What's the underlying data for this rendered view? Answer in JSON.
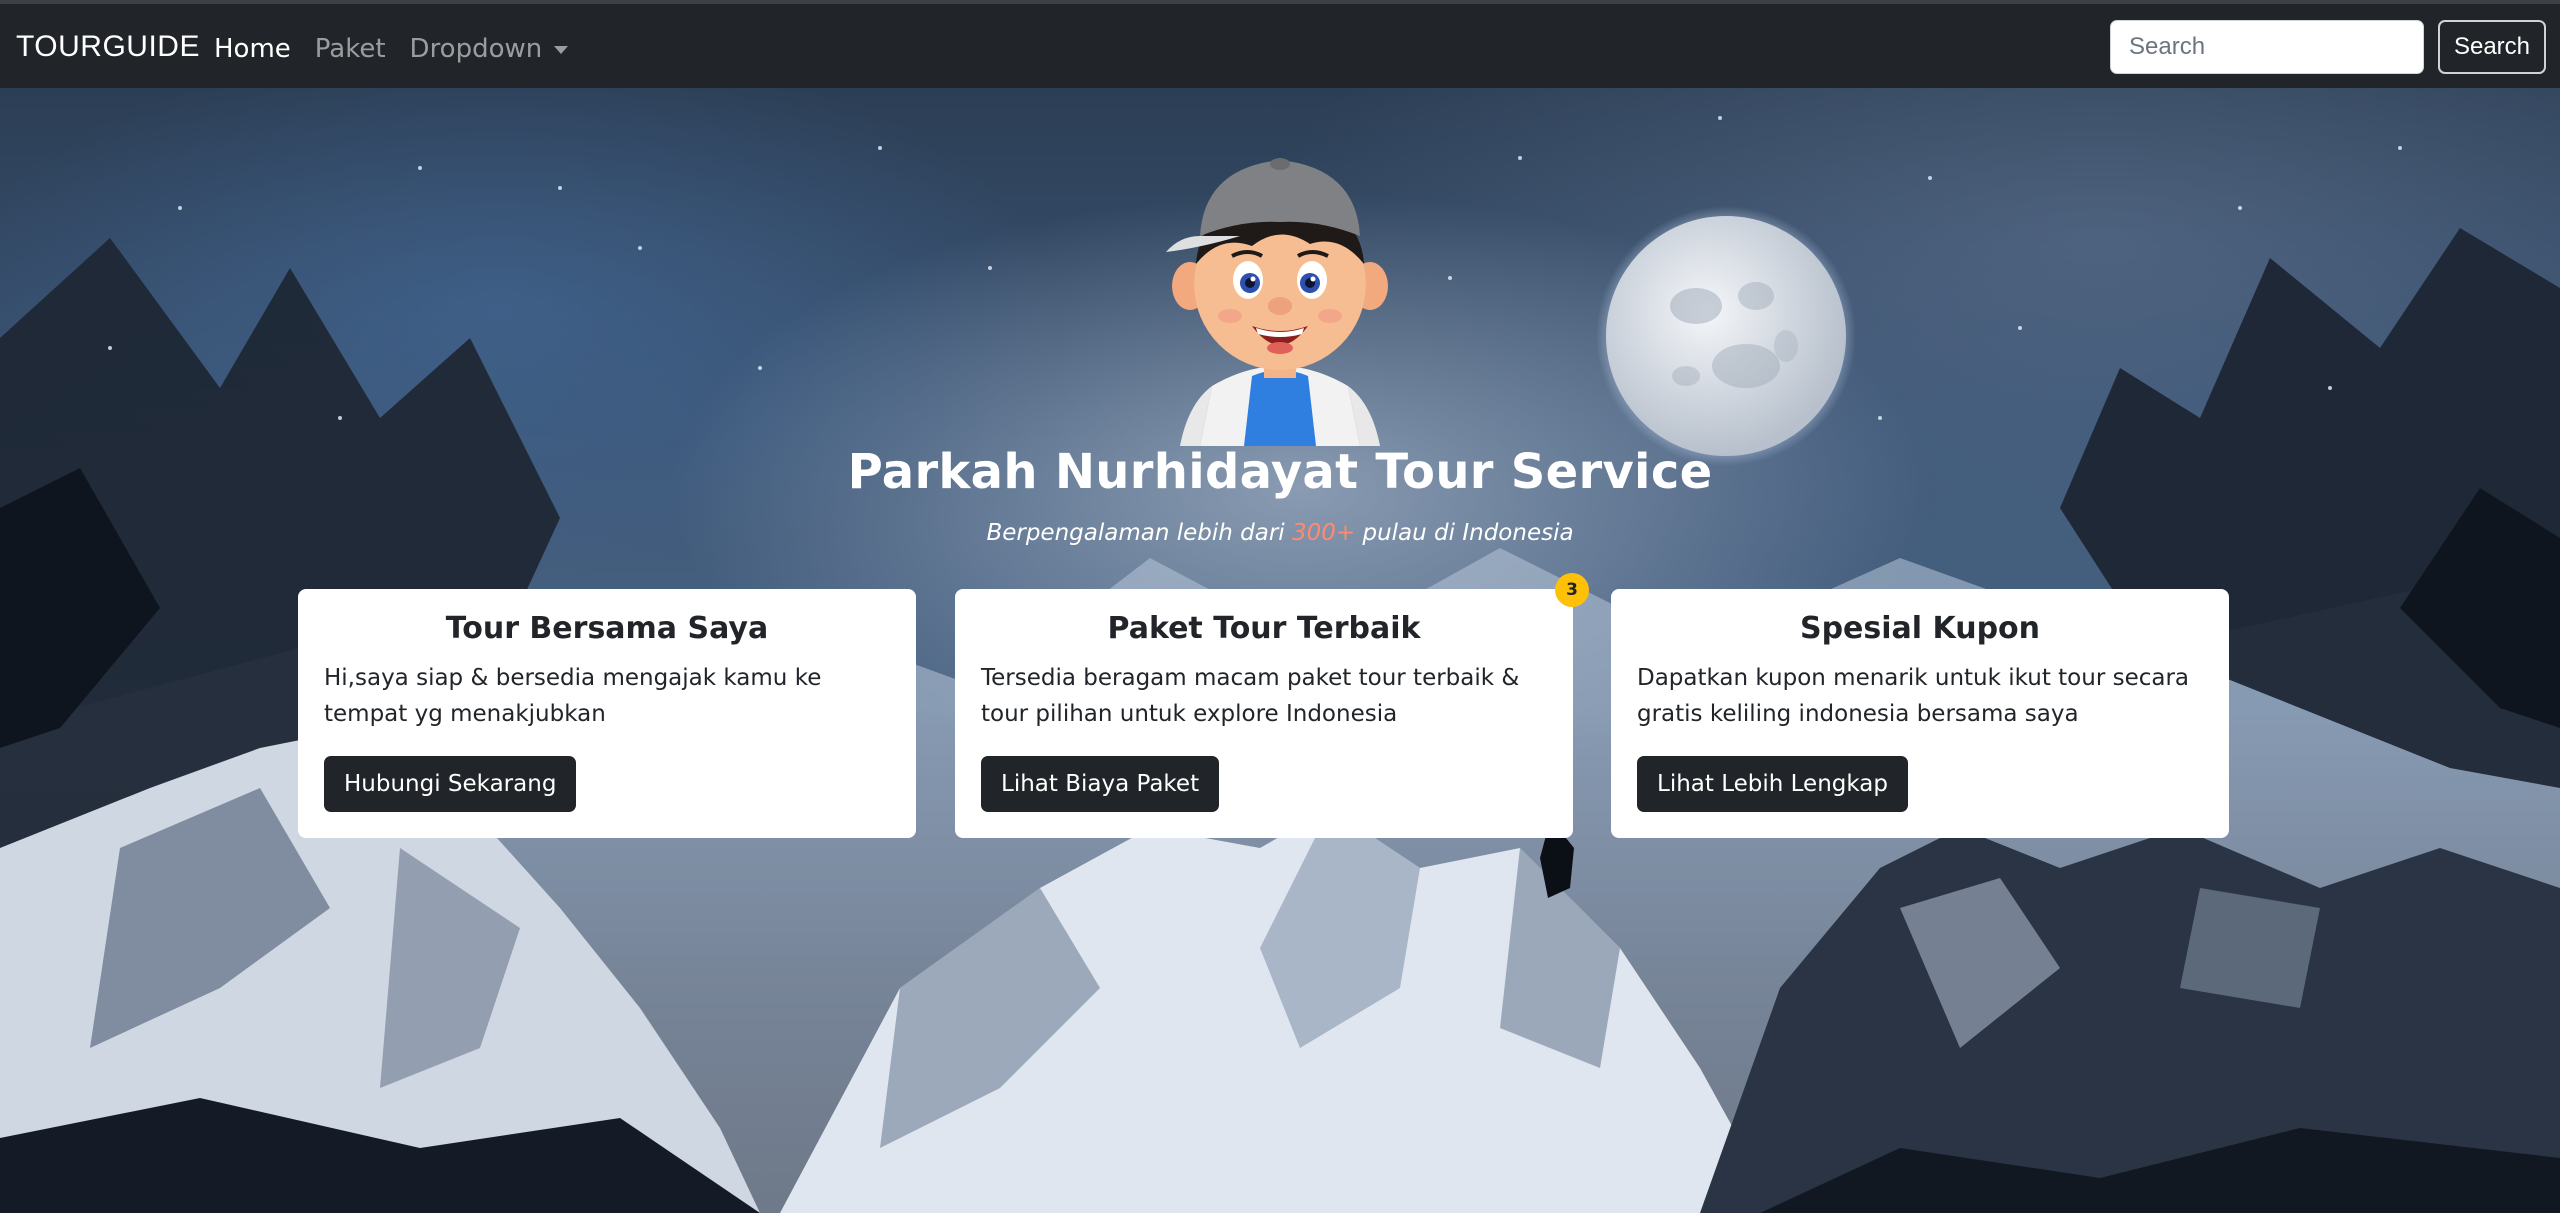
{
  "navbar": {
    "brand": "TOURGUIDE",
    "links": [
      {
        "label": "Home",
        "active": true
      },
      {
        "label": "Paket",
        "active": false
      },
      {
        "label": "Dropdown",
        "active": false
      }
    ],
    "search_placeholder": "Search",
    "search_button": "Search"
  },
  "hero": {
    "title": "Parkah Nurhidayat Tour Service",
    "subtitle_before": "Berpengalaman lebih dari ",
    "subtitle_highlight": "300+",
    "subtitle_after": " pulau di Indonesia"
  },
  "cards": [
    {
      "title": "Tour Bersama Saya",
      "text": "Hi,saya siap & bersedia mengajak kamu ke tempat yg menakjubkan",
      "button": "Hubungi Sekarang"
    },
    {
      "title": "Paket Tour Terbaik",
      "text": "Tersedia beragam macam paket tour terbaik & tour pilihan untuk explore Indonesia",
      "button": "Lihat Biaya Paket",
      "badge": "3"
    },
    {
      "title": "Spesial Kupon",
      "text": "Dapatkan kupon menarik untuk ikut tour secara gratis keliling indonesia bersama saya",
      "button": "Lihat Lebih Lengkap"
    }
  ],
  "colors": {
    "navbar_bg": "#212529",
    "button_dark": "#212529",
    "badge": "#ffc107",
    "highlight": "#ff8a70"
  },
  "icons": {
    "dropdown": "chevron-down-icon",
    "avatar": "cartoon-boy-avatar",
    "moon": "full-moon-illustration"
  }
}
